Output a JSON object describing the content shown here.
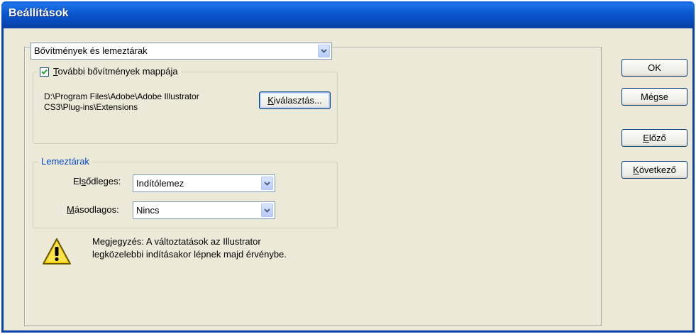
{
  "window": {
    "title": "Beállítások"
  },
  "category_select": {
    "value": "Bővítmények és lemeztárak"
  },
  "plugins_group": {
    "checkbox_mnemonic": "T",
    "checkbox_rest": "ovábbi bővítmények mappája",
    "checked": true,
    "path_line1": "D:\\Program Files\\Adobe\\Adobe Illustrator",
    "path_line2": "CS3\\Plug-ins\\Extensions",
    "choose_mnemonic": "K",
    "choose_rest": "iválasztás..."
  },
  "scratch_group": {
    "title": "Lemeztárak",
    "primary_pre": "El",
    "primary_mnemonic": "s",
    "primary_post": "ődleges:",
    "primary_value": "Indítólemez",
    "secondary_mnemonic": "M",
    "secondary_post": "ásodlagos:",
    "secondary_value": "Nincs"
  },
  "note": {
    "icon": "warning-icon",
    "line1": "Megjegyzés: A változtatások az Illustrator",
    "line2": "legközelebbi indításakor lépnek majd érvénybe."
  },
  "buttons": {
    "ok": "OK",
    "cancel": "Mégse",
    "prev_mnemonic": "E",
    "prev_rest": "lőző",
    "next_mnemonic": "K",
    "next_rest": "övetkező"
  },
  "colors": {
    "titlebar": "#0a57cf",
    "dialog": "#ece9d8",
    "group_title": "#0046d5"
  }
}
